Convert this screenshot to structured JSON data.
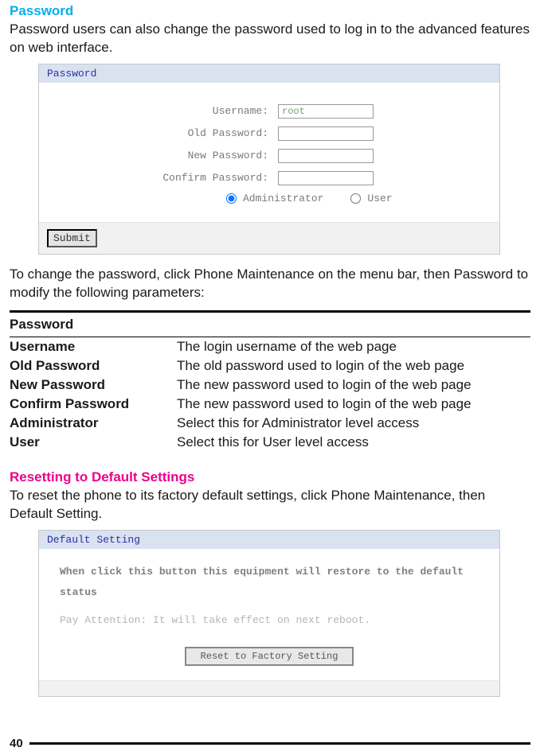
{
  "section1": {
    "heading": "Password",
    "paragraph": "Password users can also change the password used to log in to the advanced features on web interface.",
    "panel_title": "Password",
    "fields": {
      "username_label": "Username:",
      "username_value": "root",
      "old_label": "Old Password:",
      "new_label": "New Password:",
      "confirm_label": "Confirm Password:",
      "admin_label": "Administrator",
      "user_label": "User",
      "submit_label": "Submit"
    },
    "paragraph2": "To change the password, click Phone Maintenance on the menu bar, then Password to modify the following parameters:"
  },
  "table": {
    "title": "Password",
    "rows": [
      {
        "k": "Username",
        "v": "The login username of the web page"
      },
      {
        "k": "Old Password",
        "v": "The old password used to login of the web page"
      },
      {
        "k": "New Password",
        "v": "The new password used to login of the web page"
      },
      {
        "k": "Confirm Password",
        "v": "The new password used to login of the web page"
      },
      {
        "k": "Administrator",
        "v": "Select this for Administrator level access"
      },
      {
        "k": "User",
        "v": "Select this for User level access"
      }
    ]
  },
  "section2": {
    "heading": "Resetting to Default Settings",
    "paragraph": "To reset the phone to its factory default settings, click Phone Maintenance, then Default Setting.",
    "panel_title": "Default Setting",
    "msg1": "When click this button this equipment will restore to the default status",
    "msg2": "Pay Attention: It will take effect on next reboot.",
    "reset_label": "Reset to Factory Setting"
  },
  "page_number": "40"
}
